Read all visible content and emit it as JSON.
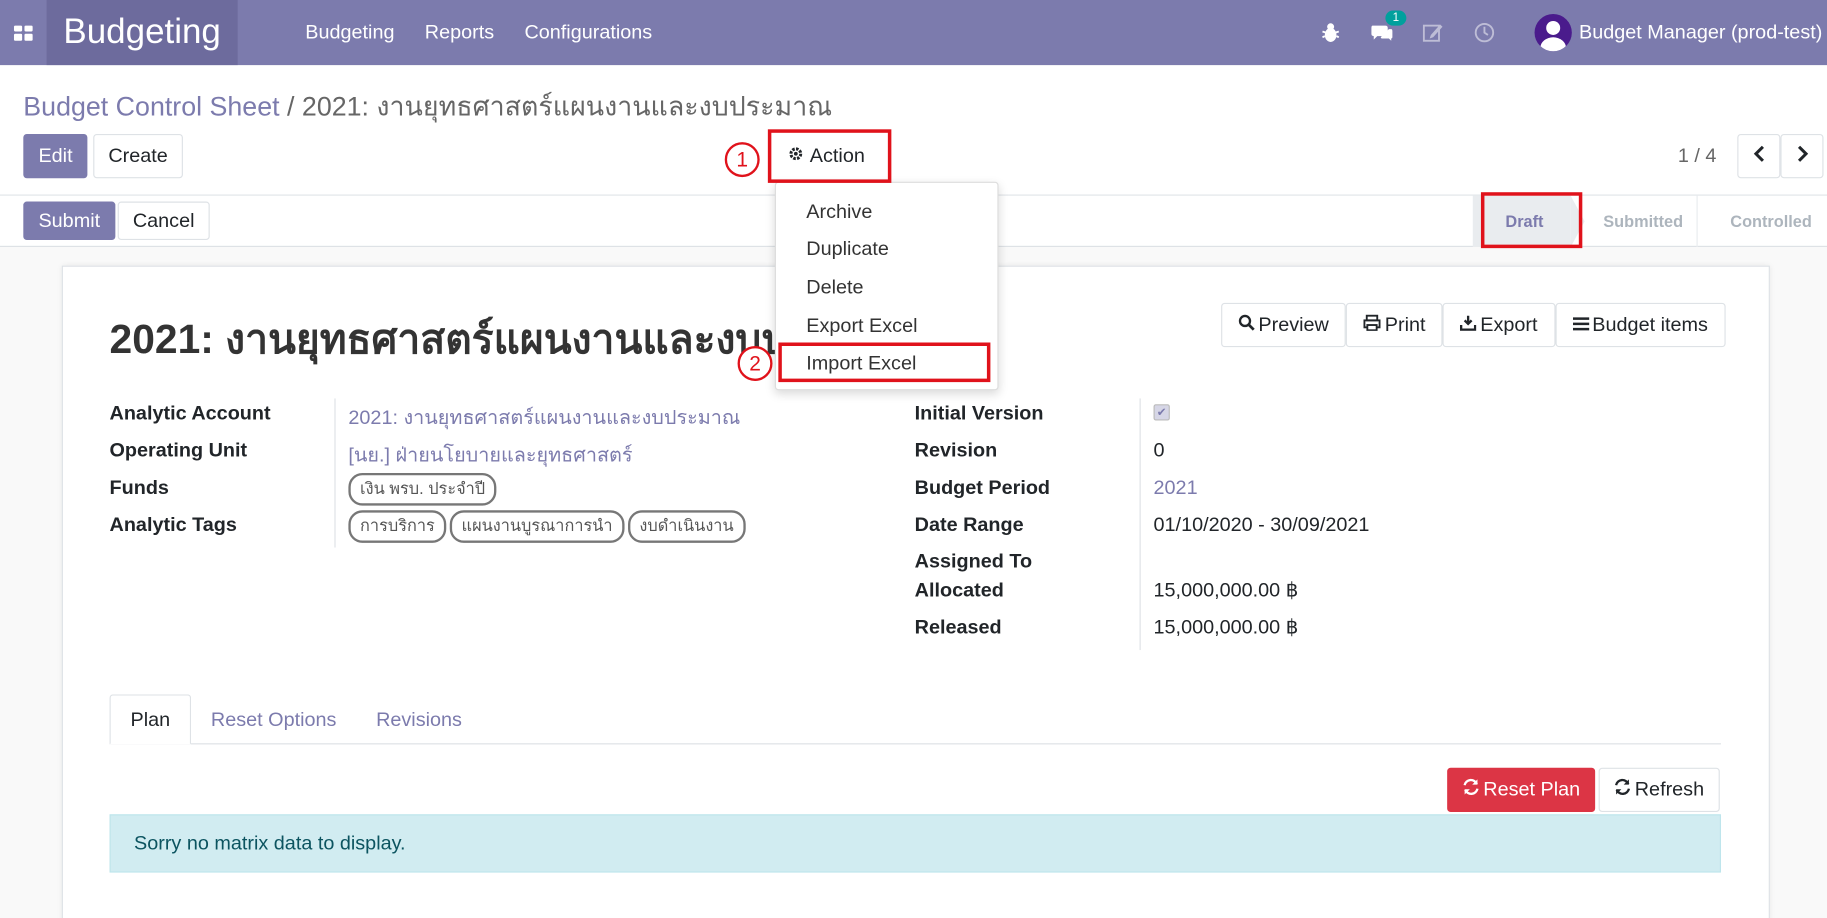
{
  "app": {
    "name": "Budgeting",
    "menu": [
      "Budgeting",
      "Reports",
      "Configurations"
    ],
    "chat_badge": "1",
    "user": "Budget Manager (prod-test)",
    "accent": "#7c7bad"
  },
  "breadcrumb": {
    "parent": "Budget Control Sheet",
    "separator": "/",
    "current": "2021: งานยุทธศาสตร์แผนงานและงบประมาณ"
  },
  "toolbar": {
    "edit": "Edit",
    "create": "Create",
    "action": "Action",
    "pager": "1 / 4"
  },
  "action_menu": [
    "Archive",
    "Duplicate",
    "Delete",
    "Export Excel",
    "Import Excel"
  ],
  "status": {
    "submit": "Submit",
    "cancel": "Cancel",
    "stages": [
      "Draft",
      "Submitted",
      "Controlled"
    ],
    "active_stage": "Draft"
  },
  "record": {
    "title": "2021: งานยุทธศาสตร์แผนงานและงบประมาณ",
    "smart_buttons": [
      "Preview",
      "Print",
      "Export",
      "Budget items"
    ],
    "left_fields": [
      {
        "label": "Analytic Account",
        "value": "2021: งานยุทธศาสตร์แผนงานและงบประมาณ"
      },
      {
        "label": "Operating Unit",
        "value": "[นย.] ฝ่ายนโยบายและยุทธศาสตร์"
      },
      {
        "label": "Funds",
        "tags": [
          "เงิน พรบ. ประจำปี"
        ]
      },
      {
        "label": "Analytic Tags",
        "tags": [
          "การบริการ",
          "แผนงานบูรณาการนำ",
          "งบดำเนินงาน"
        ]
      }
    ],
    "right_fields": [
      {
        "label": "Initial Version",
        "value": ""
      },
      {
        "label": "Revision",
        "value": "0"
      },
      {
        "label": "Budget Period",
        "value": "2021"
      },
      {
        "label": "Date Range",
        "value": "01/10/2020 - 30/09/2021"
      },
      {
        "label": "Assigned To",
        "value": ""
      },
      {
        "label": "Allocated",
        "value": "15,000,000.00 ฿"
      },
      {
        "label": "Released",
        "value": "15,000,000.00 ฿"
      }
    ],
    "initial_version_checked": true
  },
  "tabs": [
    "Plan",
    "Reset Options",
    "Revisions"
  ],
  "plan": {
    "reset_plan": "Reset Plan",
    "refresh": "Refresh",
    "message": "Sorry no matrix data to display."
  },
  "annotations": {
    "step1": "1",
    "step2": "2",
    "color": "#e0121b"
  }
}
